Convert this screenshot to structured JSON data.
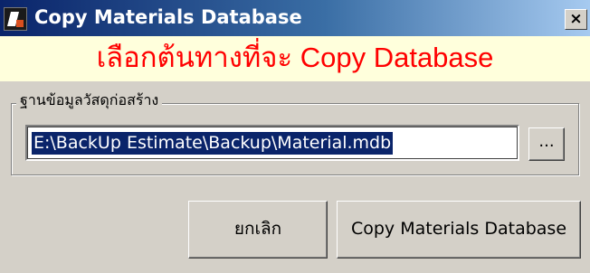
{
  "window": {
    "title": "Copy Materials Database",
    "close_glyph": "×",
    "icon": "app-icon"
  },
  "banner": {
    "text": "เลือกต้นทางที่จะ Copy Database",
    "color": "#ff0000",
    "background": "#ffffdc"
  },
  "source_group": {
    "label": "ฐานข้อมูลวัสดุก่อสร้าง",
    "path_value": "E:\\BackUp Estimate\\Backup\\Material.mdb",
    "browse_label": "..."
  },
  "buttons": {
    "cancel_label": "ยกเลิก",
    "copy_label": "Copy Materials Database"
  },
  "colors": {
    "titlebar_start": "#0a246a",
    "titlebar_end": "#a6caf0",
    "selection": "#0a246a",
    "face": "#d4d0c8"
  }
}
